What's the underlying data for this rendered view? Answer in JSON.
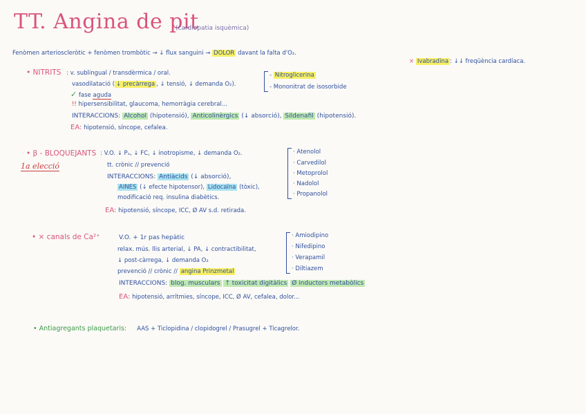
{
  "title": "TT. Angina de pit",
  "subtitle": "(cardiopatia isquèmica)",
  "intro": "Fenòmen arterioscleròtic + fenòmen trombòtic → ↓ flux sanguini → DOLOR davant la falta d'O₂.",
  "intro_parts": {
    "pre": "Fenòmen arterioscleròtic + fenòmen trombòtic → ↓ flux sanguini →",
    "highlight": "DOLOR",
    "post": "davant la falta d'O₂."
  },
  "ivabradina": {
    "bullet": "×",
    "name": "Ivabradina",
    "text": ": ↓↓ freqüència cardíaca."
  },
  "nitrits": {
    "heading": "NITRITS",
    "lines": {
      "l1": ": v. sublingual / transdèrmica / oral.",
      "l2_pre": "vasodilatació (",
      "l2_hl": "↓ precàrrega",
      "l2_post": ", ↓ tensió, ↓ demanda O₂).",
      "l3_check": "✓",
      "l3_pre": "fase",
      "l3_u": "aguda",
      "l4_mark": "!!",
      "l4": "hipersensibilitat, glaucoma, hemorràgia cerebral...",
      "inter_label": "INTERACCIONS:",
      "inter_1": "Alcohol",
      "inter_1b": "(hipotensió),",
      "inter_2": "Anticolinèrgics",
      "inter_2b": "(↓ absorció),",
      "inter_3": "Sildenafil",
      "inter_3b": "(hipotensió).",
      "ea_label": "EA:",
      "ea": "hipotensió, síncope, cefalea."
    },
    "drugs": [
      "Nitroglicerina",
      "Mononitrat de isosorbide"
    ]
  },
  "beta": {
    "heading": "β - BLOQUEJANTS",
    "note": "1a elecció",
    "lines": {
      "l1": ": V.O.   ↓ Pₐ, ↓ FC, ↓ inotropisme, ↓ demanda O₂.",
      "l2": "tt. crònic // prevenció",
      "inter_label": "INTERACCIONS:",
      "inter_1": "Antiàcids",
      "inter_1b": "(↓ absorció),",
      "inter_2": "AINES",
      "inter_2b": "(↓ efecte hipotensor),",
      "inter_3": "Lidocaïna",
      "inter_3b": "(tòxic),",
      "l5": "modificació req. insulina diabètics.",
      "ea_label": "EA:",
      "ea": "hipotensió, síncope, ICC, Ø AV s.d. retirada."
    },
    "drugs": [
      "Atenolol",
      "Carvedilol",
      "Metoprolol",
      "Nadolol",
      "Propanolol"
    ]
  },
  "calcium": {
    "heading": "× canals de Ca²⁺",
    "lines": {
      "l1": "V.O. + 1r pas hepàtic",
      "l2": "relax. mús. llis arterial, ↓ PA, ↓ contractibilitat,",
      "l3": "↓ post-càrrega, ↓ demanda O₂",
      "l4_pre": "prevenció // crònic //",
      "l4_hl": "angina Prinzmetal",
      "inter_label": "INTERACCIONS:",
      "inter_1": "blog. musculars",
      "inter_2": "↑ toxicitat digitàlics",
      "inter_3": "Ø inductors metabòlics",
      "ea_label": "EA:",
      "ea": "hipotensió, arrítmies, síncope, ICC, Ø AV, cefalea, dolor..."
    },
    "drugs": [
      "Amiodipino",
      "Nifedipino",
      "Verapamil",
      "Diltiazem"
    ]
  },
  "antiagregants": {
    "heading": "Antiagregants plaquetaris:",
    "text": "AAS   +   Ticlopidina / clopidogrel / Prasugrel   +   Ticagrelor."
  }
}
